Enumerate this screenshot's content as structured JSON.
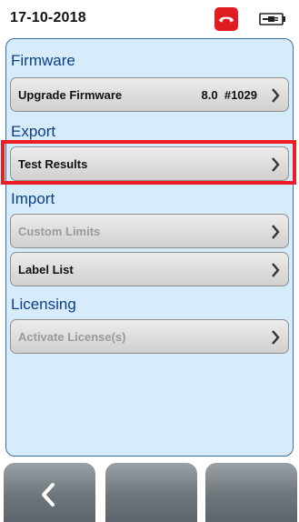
{
  "status": {
    "date": "17-10-2018",
    "phone_icon": "hang-up-phone-icon",
    "battery_icon": "battery-plug-icon"
  },
  "sections": [
    {
      "header": "Firmware",
      "items": [
        {
          "label": "Upgrade Firmware",
          "value": "8.0  #1029",
          "enabled": true
        }
      ]
    },
    {
      "header": "Export",
      "items": [
        {
          "label": "Test Results",
          "value": "",
          "enabled": true,
          "highlighted": true
        }
      ]
    },
    {
      "header": "Import",
      "items": [
        {
          "label": "Custom Limits",
          "value": "",
          "enabled": false
        },
        {
          "label": "Label List",
          "value": "",
          "enabled": true
        }
      ]
    },
    {
      "header": "Licensing",
      "items": [
        {
          "label": "Activate License(s)",
          "value": "",
          "enabled": false
        }
      ]
    }
  ],
  "softkeys": [
    {
      "icon": "back-arrow-icon"
    },
    {
      "icon": ""
    },
    {
      "icon": ""
    }
  ],
  "colors": {
    "accent_header": "#0c3f87",
    "panel_bg": "#d7ecfb",
    "highlight": "#ee1c24",
    "phone_red": "#e11b22"
  }
}
